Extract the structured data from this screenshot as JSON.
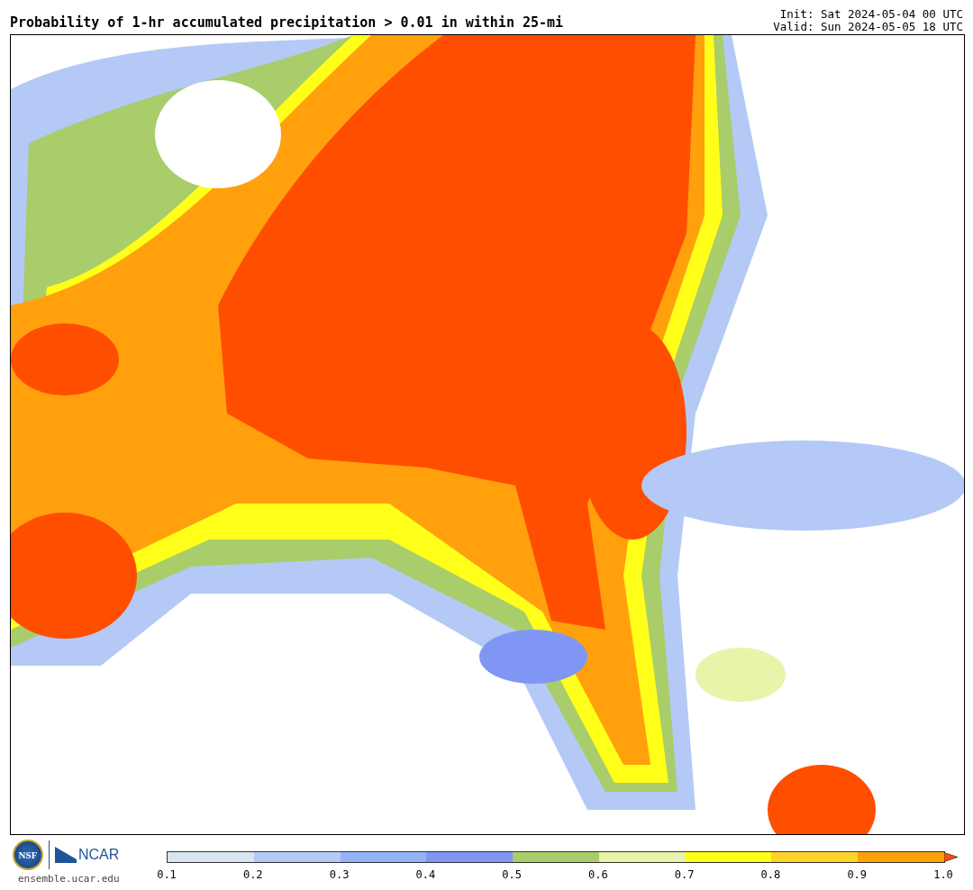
{
  "header": {
    "title": "Probability of 1-hr accumulated precipitation > 0.01 in within 25-mi",
    "init": "Init: Sat 2024-05-04 00 UTC",
    "valid": "Valid: Sun 2024-05-05 18 UTC"
  },
  "footer": {
    "logo_left": "NSF",
    "logo_right": "NCAR",
    "site": "ensemble.ucar.edu"
  },
  "colorbar": {
    "bins": [
      {
        "color": "#d9e4ef"
      },
      {
        "color": "#b4c9f5"
      },
      {
        "color": "#94b2f7"
      },
      {
        "color": "#7f96f5"
      },
      {
        "color": "#a8cd6a"
      },
      {
        "color": "#e9f3a9"
      },
      {
        "color": "#ffff1a"
      },
      {
        "color": "#fdd22a"
      },
      {
        "color": "#ffa00c"
      }
    ],
    "over": {
      "color": "#ff4e00"
    },
    "ticks": [
      "0.1",
      "0.2",
      "0.3",
      "0.4",
      "0.5",
      "0.6",
      "0.7",
      "0.8",
      "0.9",
      "1.0"
    ]
  }
}
